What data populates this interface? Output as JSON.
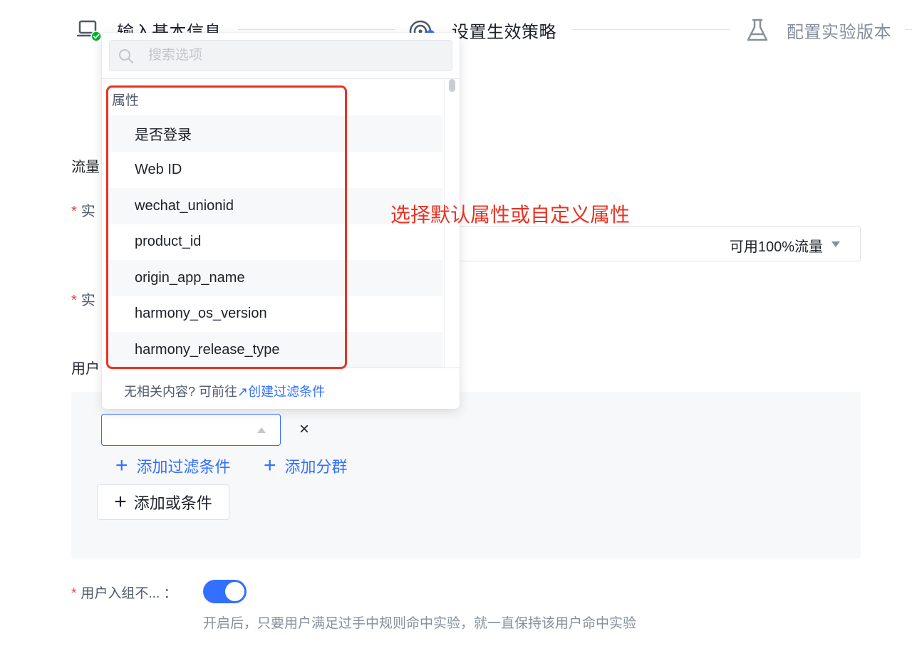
{
  "steps": [
    {
      "label": "输入基本信息",
      "icon": "laptop-check-icon",
      "status": "done"
    },
    {
      "label": "设置生效策略",
      "icon": "target-icon",
      "status": "active"
    },
    {
      "label": "配置实验版本",
      "icon": "flask-icon",
      "status": "pending"
    }
  ],
  "form": {
    "traffic_section_label": "流量",
    "field_label_1": "实",
    "field_label_2": "实",
    "traffic_select_value": "可用100%流量",
    "user_section_label": "用户",
    "required_mark": "*"
  },
  "filter": {
    "remove_label": "×",
    "add_filter_label": "添加过滤条件",
    "add_segment_label": "添加分群",
    "add_or_label": "添加或条件",
    "plus": "+"
  },
  "toggle": {
    "label": "用户入组不... ：",
    "on": true,
    "hint": "开启后，只要用户满足过手中规则命中实验，就一直保持该用户命中实验"
  },
  "dropdown": {
    "search_placeholder": "搜索选项",
    "group_title": "属性",
    "items": [
      "是否登录",
      "Web ID",
      "wechat_unionid",
      "product_id",
      "origin_app_name",
      "harmony_os_version",
      "harmony_release_type"
    ],
    "footer_text": "无相关内容? 可前往",
    "footer_link_arrow": "↗",
    "footer_link": "创建过滤条件"
  },
  "annotation": {
    "text": "选择默认属性或自定义属性",
    "color": "#ea3323"
  },
  "colors": {
    "primary": "#3370ff",
    "required": "#f53f3f",
    "success": "#00b42a"
  }
}
